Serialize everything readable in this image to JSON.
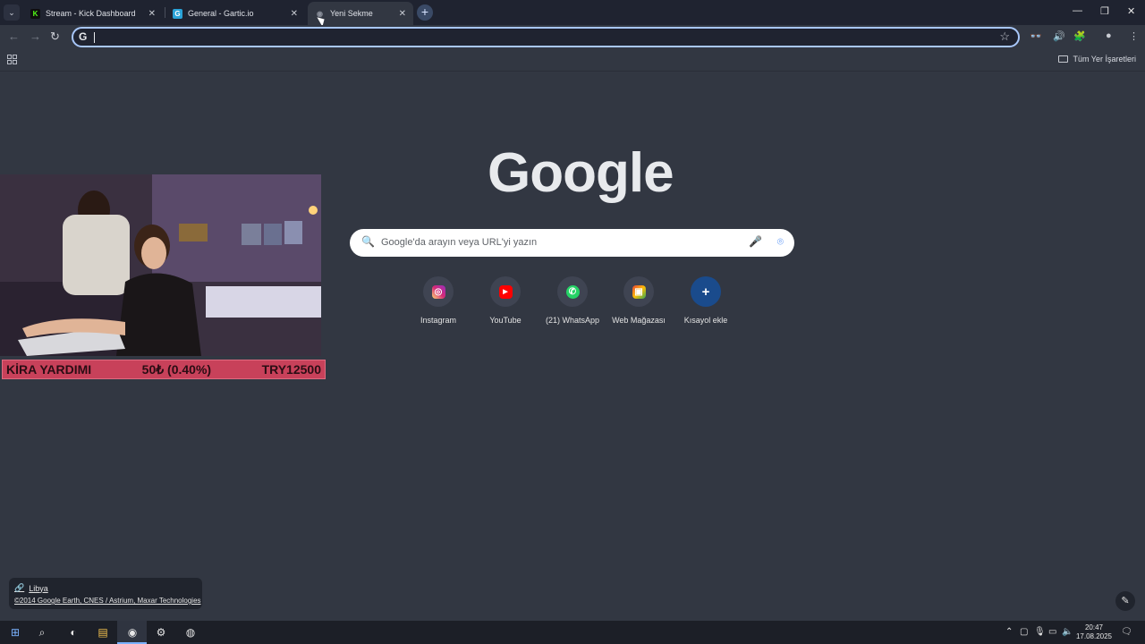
{
  "browser": {
    "tabs": [
      {
        "title": "Stream - Kick Dashboard",
        "favicon": "kick-icon",
        "color": "#53fc18",
        "active": false
      },
      {
        "title": "General - Gartic.io",
        "favicon": "gartic-icon",
        "color": "#2aa3d8",
        "active": false
      },
      {
        "title": "Yeni Sekme",
        "favicon": "chrome-icon",
        "color": "#8a8f9a",
        "active": true
      }
    ],
    "new_tab_symbol": "+",
    "omnibox_value": "",
    "bookmarks_all": "Tüm Yer İşaretleri"
  },
  "newtab": {
    "logo": "Google",
    "search_placeholder": "Google'da arayın veya URL'yi yazın",
    "shortcuts": [
      {
        "label": "Instagram",
        "icon": "instagram-icon",
        "color": "#d6249f"
      },
      {
        "label": "YouTube",
        "icon": "youtube-icon",
        "color": "#ff0000"
      },
      {
        "label": "(21) WhatsApp",
        "icon": "whatsapp-icon",
        "color": "#25d366"
      },
      {
        "label": "Web Mağazası",
        "icon": "webstore-icon",
        "color": "#e8eaed"
      },
      {
        "label": "Kısayol ekle",
        "icon": "plus-icon",
        "color": "#1a4b8c"
      }
    ],
    "background_credit": {
      "location": "Libya",
      "copyright": "©2014 Google Earth, CNES / Astrium, Maxar Technologies"
    }
  },
  "stream_overlay": {
    "goal_label": "KİRA YARDIMI",
    "goal_progress": "50₺ (0.40%)",
    "goal_target": "TRY12500"
  },
  "taskbar": {
    "time": "20:47",
    "date": "17.08.2025"
  }
}
